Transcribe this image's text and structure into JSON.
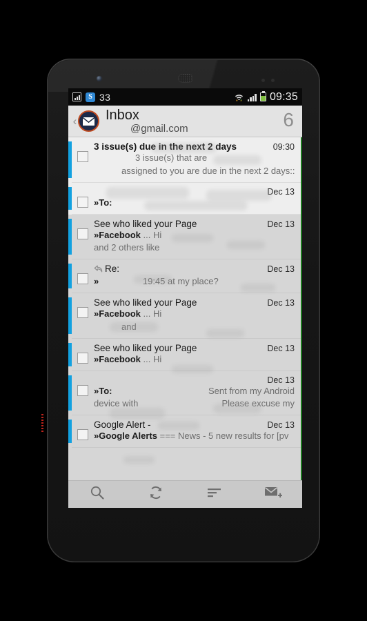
{
  "statusbar": {
    "signal_icon": "signal-bars-icon",
    "skype_icon_label": "S",
    "notification_count": "33",
    "wifi_icon": "wifi-transfer-icon",
    "cell_icon": "cell-signal-icon",
    "battery_icon": "battery-icon",
    "time": "09:35"
  },
  "appbar": {
    "back_chevron": "‹",
    "app_icon": "envelope-circle-icon",
    "folder_title": "Inbox",
    "account": "@gmail.com",
    "unread_count": "6"
  },
  "messages": [
    {
      "subject": "3 issue(s) due in the next 2 days",
      "bold": true,
      "date": "09:30",
      "snippet_line1": "3 issue(s) that are",
      "snippet_line1_align": "center",
      "snippet_line2": "assigned to you are due in the next 2 days:: *",
      "snippet_line2_align": "center",
      "background": "light",
      "has_reply_icon": false
    },
    {
      "subject": "",
      "bold": false,
      "date": "Dec 13",
      "sender": "»To:",
      "snippet_line1": "",
      "snippet_line2": "",
      "background": "light",
      "has_reply_icon": false
    },
    {
      "subject": "See who liked your Page",
      "bold": false,
      "date": "Dec 13",
      "sender": "»Facebook",
      "snippet_line1": "... Hi",
      "snippet_line2": "and 2 others like",
      "background": "dark",
      "has_reply_icon": false
    },
    {
      "subject": "Re:",
      "bold": false,
      "date": "Dec 13",
      "sender": "»",
      "snippet_line1": "19:45 at my place?",
      "snippet_line1_align": "center",
      "snippet_line2": "",
      "background": "dark",
      "has_reply_icon": true
    },
    {
      "subject": "See who liked your Page",
      "bold": false,
      "date": "Dec 13",
      "sender": "»Facebook",
      "snippet_line1": "... Hi",
      "snippet_line2": "and",
      "snippet_line2_align": "center",
      "background": "dark",
      "has_reply_icon": false
    },
    {
      "subject": "See who liked your Page",
      "bold": false,
      "date": "Dec 13",
      "sender": "»Facebook",
      "snippet_line1": "... Hi",
      "snippet_line2": "",
      "background": "dark",
      "has_reply_icon": false
    },
    {
      "subject": "",
      "bold": false,
      "date": "Dec 13",
      "sender": "»To:",
      "snippet_line1": "Sent from my Android",
      "snippet_line1_align": "right",
      "snippet_line2": "device with",
      "snippet_line2_extra": "Please excuse my",
      "background": "dark",
      "has_reply_icon": false
    },
    {
      "subject": "Google Alert -",
      "bold": false,
      "date": "Dec 13",
      "sender": "»Google Alerts",
      "snippet_line1": "=== News - 5 new results for [pv",
      "snippet_line2": "",
      "background": "dark",
      "has_reply_icon": false
    }
  ],
  "toolbar": {
    "buttons": [
      {
        "name": "search-icon",
        "label": "Search"
      },
      {
        "name": "refresh-icon",
        "label": "Refresh"
      },
      {
        "name": "sort-icon",
        "label": "Sort"
      },
      {
        "name": "compose-icon",
        "label": "Compose"
      }
    ]
  },
  "colors": {
    "accent_stripe": "#12a1e0",
    "app_icon_ring": "#bf4a20",
    "app_icon_fill": "#1c2a4a",
    "row_light": "#eeeeee",
    "row_dark": "#d6d6d6",
    "appbar": "#e3e3e3",
    "toolbar": "#c9c9c9",
    "battery_green": "#7fbf3f",
    "scroll_indicator": "#1d7a20"
  }
}
